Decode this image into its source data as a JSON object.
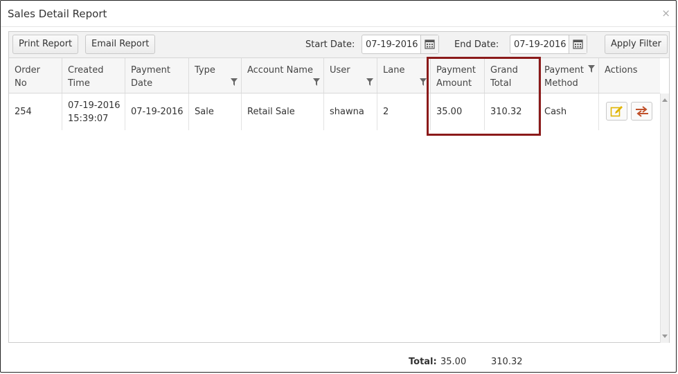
{
  "window": {
    "title": "Sales Detail Report",
    "close_glyph": "×"
  },
  "toolbar": {
    "print_label": "Print Report",
    "email_label": "Email Report",
    "start_label": "Start Date:",
    "start_value": "07-19-2016",
    "end_label": "End Date:",
    "end_value": "07-19-2016",
    "apply_label": "Apply Filter"
  },
  "table": {
    "columns": [
      {
        "line1": "Order",
        "line2": "No"
      },
      {
        "line1": "Created",
        "line2": "Time"
      },
      {
        "line1": "Payment",
        "line2": "Date"
      },
      {
        "line1": "",
        "line2": "Type"
      },
      {
        "line1": "",
        "line2": "Account Name"
      },
      {
        "line1": "",
        "line2": "User"
      },
      {
        "line1": "",
        "line2": "Lane"
      },
      {
        "line1": "Payment",
        "line2": "Amount"
      },
      {
        "line1": "Grand",
        "line2": "Total"
      },
      {
        "line1": "Payment",
        "line2": "Method"
      },
      {
        "line1": "",
        "line2": "Actions"
      }
    ],
    "rows": [
      {
        "order_no": "254",
        "created_date": "07-19-2016",
        "created_time": "15:39:07",
        "payment_date": "07-19-2016",
        "type": "Sale",
        "account_name": "Retail Sale",
        "user": "shawna",
        "lane": "2",
        "payment_amount": "35.00",
        "grand_total": "310.32",
        "payment_method": "Cash"
      }
    ]
  },
  "footer": {
    "total_label": "Total:",
    "payment_total": "35.00",
    "grand_total": "310.32"
  },
  "icons": {
    "filter": "funnel-icon",
    "calendar": "calendar-icon",
    "edit": "edit-icon",
    "swap": "swap-arrows-icon",
    "close": "close-icon"
  },
  "colors": {
    "highlight_border": "#8b1a1a",
    "edit_icon": "#e0b400",
    "swap_icon": "#c0502a",
    "funnel": "#666666"
  }
}
